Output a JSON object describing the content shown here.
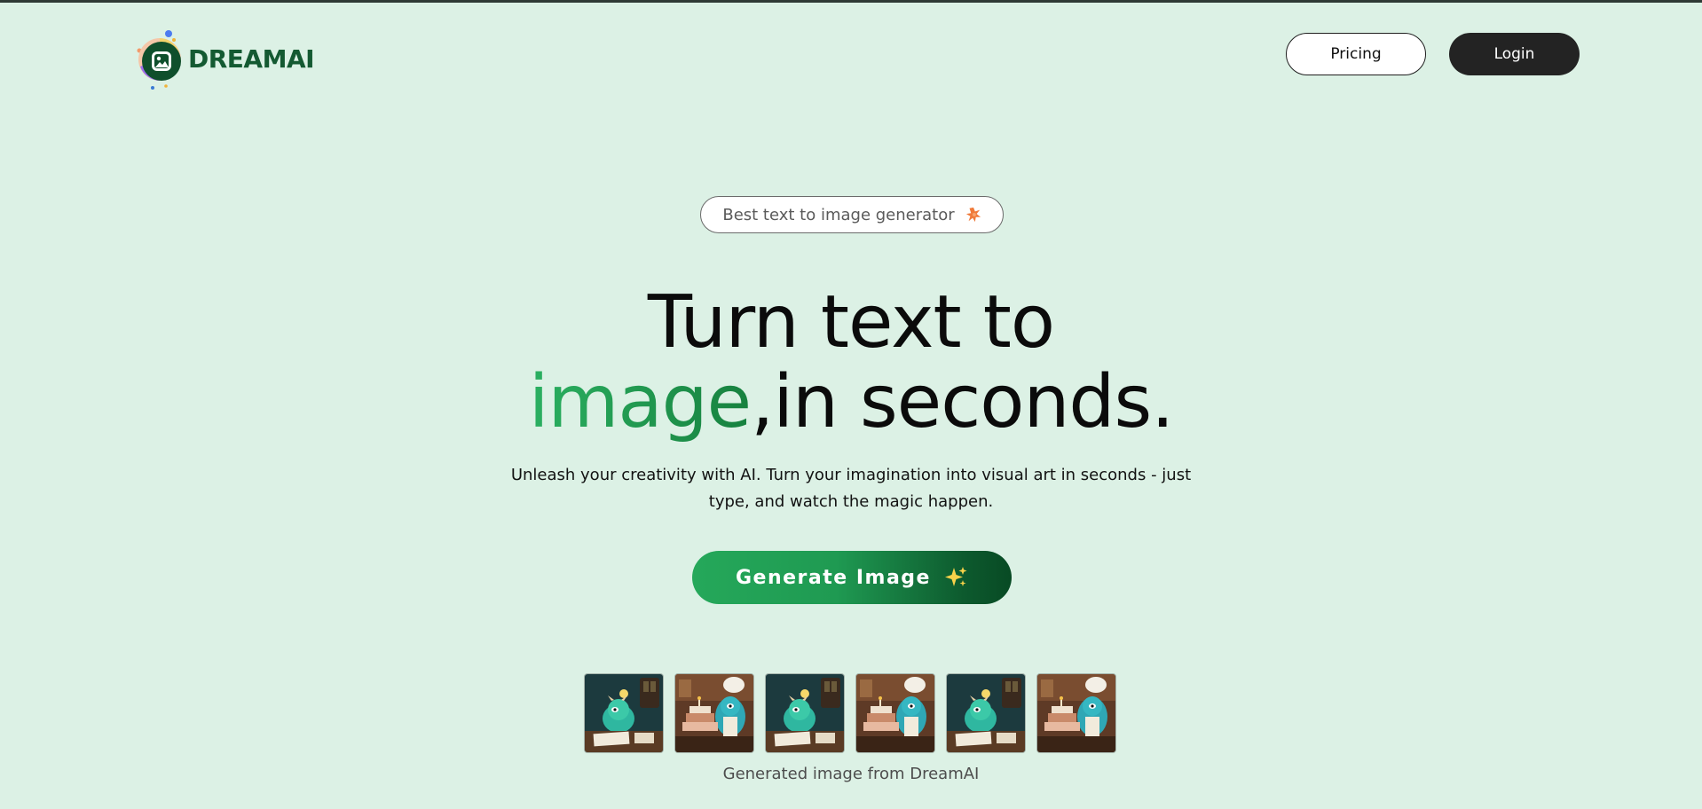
{
  "header": {
    "logo_text": "DREAMAI",
    "pricing_label": "Pricing",
    "login_label": "Login"
  },
  "hero": {
    "badge_text": "Best text to image generator",
    "badge_icon": "star-burst-icon",
    "headline_line1": "Turn text to",
    "headline_highlight": "image",
    "headline_line2_rest": ",in seconds.",
    "subtext": "Unleash your creativity with AI. Turn your imagination into visual art in seconds - just type, and watch the magic happen.",
    "cta_label": "Generate Image",
    "cta_icon": "sparkles-icon"
  },
  "gallery": {
    "thumbnails": [
      {
        "variant": "monster-writing"
      },
      {
        "variant": "monster-cake"
      },
      {
        "variant": "monster-writing"
      },
      {
        "variant": "monster-cake"
      },
      {
        "variant": "monster-writing"
      },
      {
        "variant": "monster-cake"
      }
    ],
    "caption": "Generated image from DreamAI"
  },
  "colors": {
    "background": "#dcf1e5",
    "accent_green": "#1f9a52",
    "brand_dark_green": "#145a32",
    "dark_button": "#232323",
    "badge_icon": "#f07a3a"
  }
}
